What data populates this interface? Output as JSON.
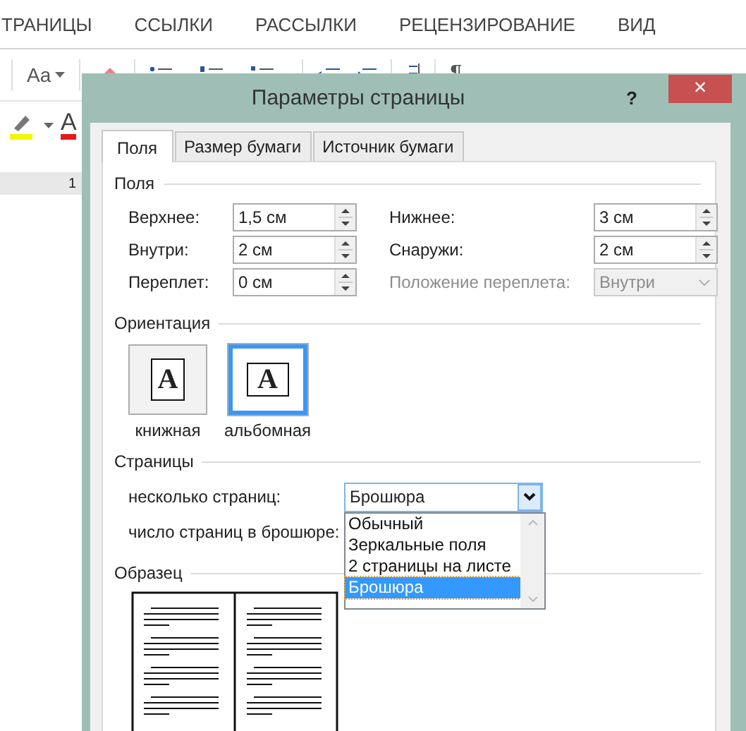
{
  "ribbon": {
    "tabs": [
      {
        "label": "ТРАНИЦЫ"
      },
      {
        "label": "ССЫЛКИ"
      },
      {
        "label": "РАССЫЛКИ"
      },
      {
        "label": "РЕЦЕНЗИРОВАНИЕ"
      },
      {
        "label": "ВИД"
      }
    ],
    "case_button": "Aa",
    "pilcrow": "¶",
    "font_color_glyph": "A",
    "ruler_number": "1"
  },
  "dialog": {
    "title": "Параметры страницы",
    "help": "?",
    "close": "×",
    "tabs": [
      {
        "label": "Поля",
        "selected": true
      },
      {
        "label": "Размер бумаги",
        "selected": false
      },
      {
        "label": "Источник бумаги",
        "selected": false
      }
    ],
    "margins": {
      "title": "Поля",
      "fields": [
        {
          "label": "Верхнее:",
          "value": "1,5 см",
          "kind": "spin",
          "disabled": false
        },
        {
          "label": "Нижнее:",
          "value": "3 см",
          "kind": "spin",
          "disabled": false
        },
        {
          "label": "Внутри:",
          "value": "2 см",
          "kind": "spin",
          "disabled": false
        },
        {
          "label": "Снаружи:",
          "value": "2 см",
          "kind": "spin",
          "disabled": false
        },
        {
          "label": "Переплет:",
          "value": "0 см",
          "kind": "spin",
          "disabled": false
        },
        {
          "label": "Положение переплета:",
          "value": "Внутри",
          "kind": "select",
          "disabled": true
        }
      ]
    },
    "orientation": {
      "title": "Ориентация",
      "options": [
        {
          "label": "книжная",
          "glyph": "A",
          "kind": "portrait",
          "selected": false
        },
        {
          "label": "альбомная",
          "glyph": "A",
          "kind": "landscape",
          "selected": true
        }
      ]
    },
    "pages": {
      "title": "Страницы",
      "multiple": {
        "label": "несколько страниц:",
        "value": "Брошюра",
        "expanded": true,
        "options": [
          {
            "label": "Обычный",
            "selected": false
          },
          {
            "label": "Зеркальные поля",
            "selected": false
          },
          {
            "label": "2 страницы на листе",
            "selected": false
          },
          {
            "label": "Брошюра",
            "selected": true
          }
        ]
      },
      "booklet_label": "число страниц в брошюре:"
    },
    "preview": {
      "title": "Образец"
    }
  }
}
